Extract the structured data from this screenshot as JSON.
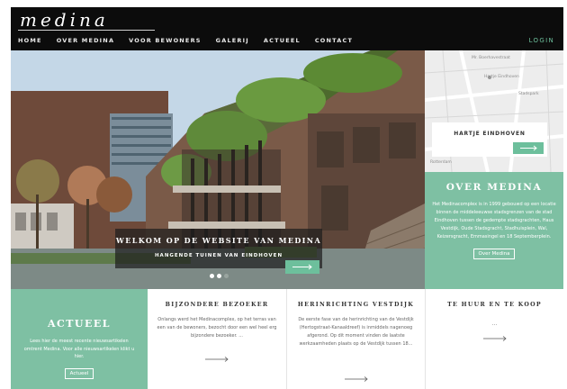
{
  "header": {
    "logo": "medina",
    "nav": [
      "HOME",
      "OVER MEDINA",
      "VOOR BEWONERS",
      "GALERIJ",
      "ACTUEEL",
      "CONTACT"
    ],
    "login": "LOGIN"
  },
  "hero": {
    "title": "WELKOM OP DE WEBSITE VAN MEDINA",
    "subtitle": "HANGENDE TUINEN VAN EINDHOVEN"
  },
  "map": {
    "labels": [
      "Mr. Boerhavestraat",
      "Hartje Eindhoven",
      "Stadspark",
      "Jan van Ruysbroeck",
      "Rotterdam"
    ],
    "box_title": "HARTJE EINDHOVEN"
  },
  "over": {
    "title": "OVER MEDINA",
    "text": "Het Medinacomplex is in 1999 gebouwd op een locatie binnen de middeleeuwse stadsgrenzen van de stad Eindhoven tussen de gedempte stadsgrachten, Haus Vestdijk, Oude Stadsgracht, Stadhuisplein, Wal, Keizersgracht, Emmasingel en 18 Septemberplein.",
    "button": "Over Medina"
  },
  "actueel": {
    "title": "ACTUEEL",
    "text": "Lees hier de meest recente nieuwsartikelen omtrent Medina. Voor alle nieuwsartikelen klikt u hier.",
    "button": "Actueel"
  },
  "cards": {
    "bijzondere": {
      "title": "BIJZONDERE BEZOEKER",
      "text": "Onlangs werd het Medinacomplex, op het terras van een van de bewoners, bezocht door een wel heel erg bijzondere bezoeker. ..."
    },
    "herinrichting": {
      "title": "HERINRICHTING VESTDIJK",
      "text": "De eerste fase van de herinrichting van de Vestdijk (Hertogstraat-Kanaaldreef) is inmiddels nagenoeg afgerond. Op dit moment vinden de laatste werkzaamheden plaats op de Vestdijk tussen 18..."
    },
    "tehuur": {
      "title": "TE HUUR EN TE KOOP",
      "text": "..."
    }
  },
  "colors": {
    "accent": "#6dbf9c",
    "panel": "#7ec0a3",
    "header_bg": "#0c0c0c"
  }
}
